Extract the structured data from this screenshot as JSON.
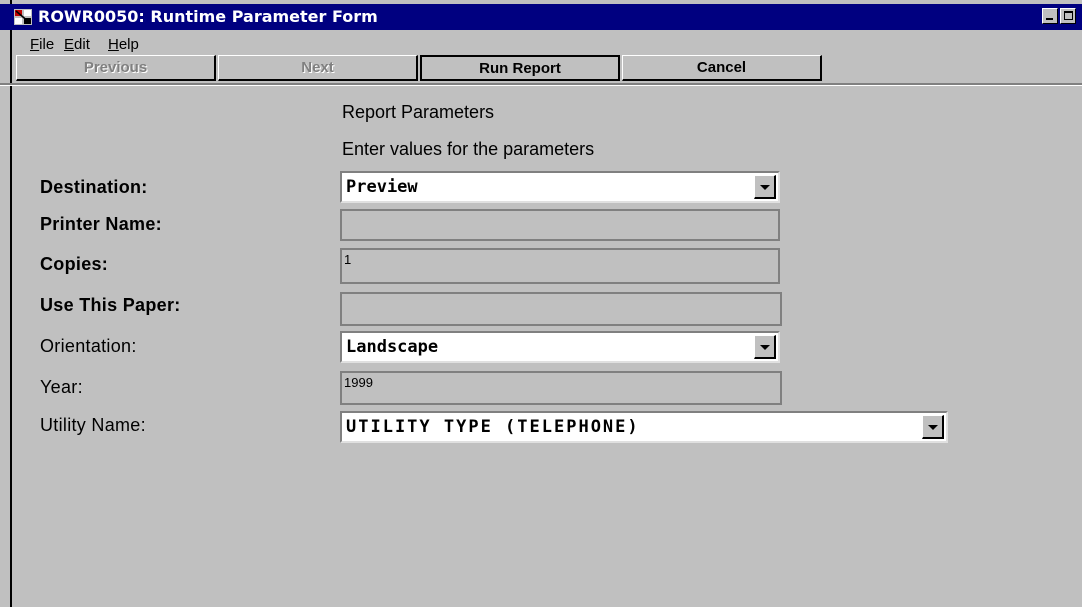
{
  "window": {
    "title": "ROWR0050: Runtime Parameter Form"
  },
  "menu": {
    "file": "File",
    "edit": "Edit",
    "help": "Help"
  },
  "toolbar": {
    "previous": "Previous",
    "next": "Next",
    "run_report": "Run Report",
    "cancel": "Cancel"
  },
  "form": {
    "heading": "Report Parameters",
    "subheading": "Enter values for the parameters",
    "destination": {
      "label": "Destination:",
      "value": "Preview"
    },
    "printer_name": {
      "label": "Printer Name:",
      "value": ""
    },
    "copies": {
      "label": "Copies:",
      "value": "1"
    },
    "paper": {
      "label": "Use This Paper:",
      "value": ""
    },
    "orientation": {
      "label": "Orientation:",
      "value": "Landscape"
    },
    "year": {
      "label": "Year:",
      "value": "1999"
    },
    "utility_name": {
      "label": "Utility Name:",
      "value": "UTILITY TYPE (TELEPHONE)"
    }
  },
  "colors": {
    "titlebar": "#000080",
    "face": "#c0c0c0"
  }
}
